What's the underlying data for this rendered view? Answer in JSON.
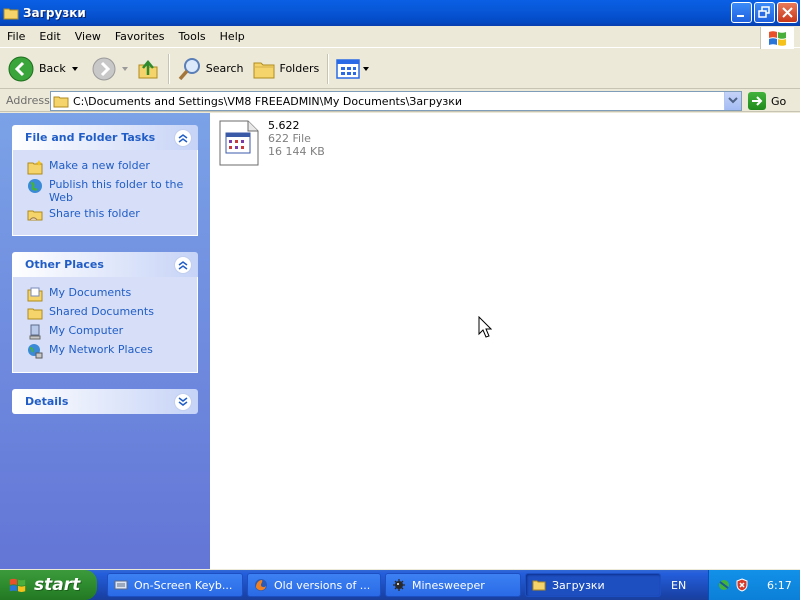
{
  "window": {
    "title": "Загрузки"
  },
  "menu": [
    "File",
    "Edit",
    "View",
    "Favorites",
    "Tools",
    "Help"
  ],
  "toolbar": {
    "back": "Back",
    "search": "Search",
    "folders": "Folders"
  },
  "address": {
    "label": "Address",
    "value": "C:\\Documents and Settings\\VM8 FREEADMIN\\My Documents\\Загрузки",
    "go": "Go"
  },
  "tasks_panel": {
    "title": "File and Folder Tasks",
    "items": [
      "Make a new folder",
      "Publish this folder to the Web",
      "Share this folder"
    ]
  },
  "places_panel": {
    "title": "Other Places",
    "items": [
      "My Documents",
      "Shared Documents",
      "My Computer",
      "My Network Places"
    ]
  },
  "details_panel": {
    "title": "Details"
  },
  "file": {
    "name": "5.622",
    "type": "622 File",
    "size": "16 144 KB"
  },
  "taskbar": {
    "start": "start",
    "buttons": [
      "On-Screen Keyb...",
      "Old versions of ...",
      "Minesweeper",
      "Загрузки"
    ],
    "lang": "EN",
    "clock": "6:17"
  },
  "colors": {
    "titlebar": "#0858d8",
    "taskpane": "#6e8fe0",
    "link": "#215dc6",
    "taskbar": "#245edb",
    "start": "#2e8b2e"
  }
}
